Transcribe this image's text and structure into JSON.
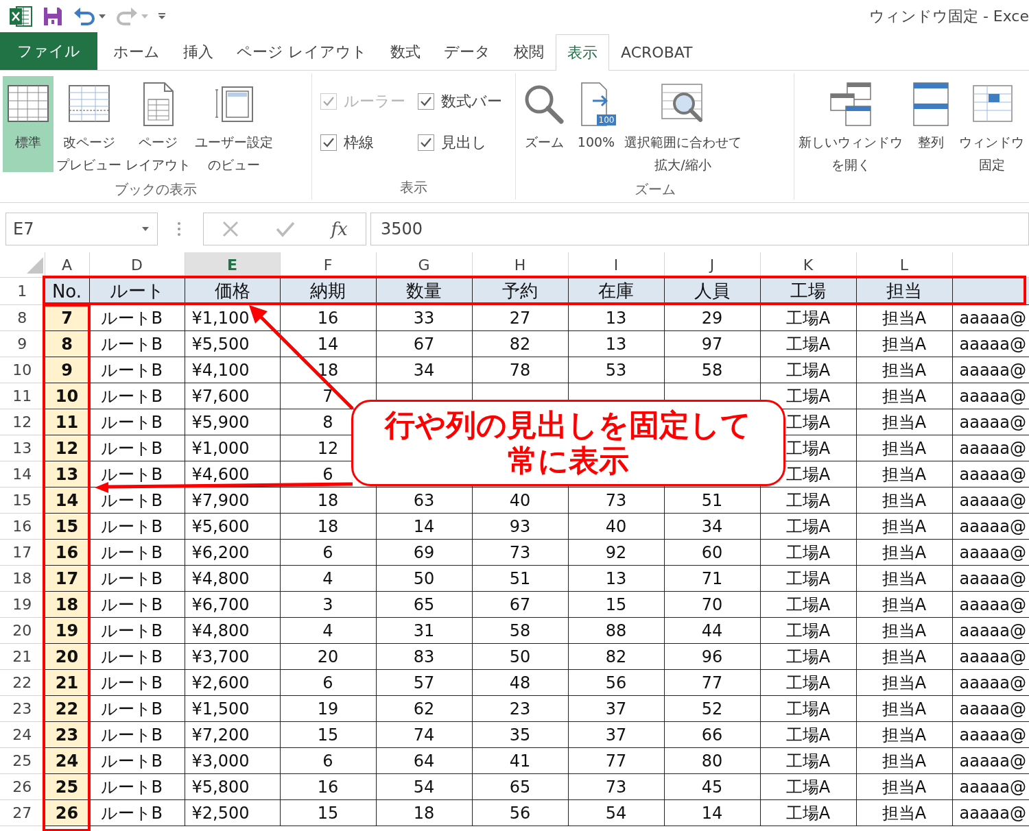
{
  "title_bar": {
    "title": "ウィンドウ固定 - Exce"
  },
  "tabs": [
    {
      "label": "ファイル",
      "kind": "file",
      "selected": false
    },
    {
      "label": "ホーム",
      "kind": "tab",
      "selected": false
    },
    {
      "label": "挿入",
      "kind": "tab",
      "selected": false
    },
    {
      "label": "ページ レイアウト",
      "kind": "tab",
      "selected": false
    },
    {
      "label": "数式",
      "kind": "tab",
      "selected": false
    },
    {
      "label": "データ",
      "kind": "tab",
      "selected": false
    },
    {
      "label": "校閲",
      "kind": "tab",
      "selected": false
    },
    {
      "label": "表示",
      "kind": "tab",
      "selected": true
    },
    {
      "label": "ACROBAT",
      "kind": "tab",
      "selected": false
    }
  ],
  "ribbon": {
    "groups": [
      {
        "label": "ブックの表示",
        "kind": "buttons",
        "items": [
          {
            "lines": [
              "標準"
            ],
            "selected": true
          },
          {
            "lines": [
              "改ページ",
              "プレビュー"
            ],
            "selected": false
          },
          {
            "lines": [
              "ページ",
              "レイアウト"
            ],
            "selected": false
          },
          {
            "lines": [
              "ユーザー設定",
              "のビュー"
            ],
            "selected": false
          }
        ]
      },
      {
        "label": "表示",
        "kind": "checks",
        "items": [
          {
            "label": "ルーラー",
            "checked": true,
            "disabled": true
          },
          {
            "label": "数式バー",
            "checked": true,
            "disabled": false
          },
          {
            "label": "枠線",
            "checked": true,
            "disabled": false
          },
          {
            "label": "見出し",
            "checked": true,
            "disabled": false
          }
        ]
      },
      {
        "label": "ズーム",
        "kind": "buttons",
        "items": [
          {
            "lines": [
              "ズーム"
            ],
            "selected": false
          },
          {
            "badge": "100",
            "lines": [
              "100%"
            ],
            "selected": false
          },
          {
            "lines": [
              "選択範囲に合わせて",
              "拡大/縮小"
            ],
            "selected": false
          }
        ]
      },
      {
        "kind": "buttons",
        "items": [
          {
            "lines": [
              "新しいウィンドウ",
              "を開く"
            ],
            "selected": false
          },
          {
            "lines": [
              "整列"
            ],
            "selected": false
          },
          {
            "lines": [
              "ウィンドウ",
              "固定"
            ],
            "selected": false
          }
        ]
      }
    ]
  },
  "formula_bar": {
    "name_box": "E7",
    "function_label": "fx",
    "value": "3500"
  },
  "sheet": {
    "columns": [
      {
        "letter": "A",
        "selected": false
      },
      {
        "letter": "D",
        "selected": false
      },
      {
        "letter": "E",
        "selected": true
      },
      {
        "letter": "F",
        "selected": false
      },
      {
        "letter": "G",
        "selected": false
      },
      {
        "letter": "H",
        "selected": false
      },
      {
        "letter": "I",
        "selected": false
      },
      {
        "letter": "J",
        "selected": false
      },
      {
        "letter": "K",
        "selected": false
      },
      {
        "letter": "L",
        "selected": false
      },
      {
        "selected": false
      }
    ],
    "header_row": {
      "row": "1",
      "cells": [
        "No.",
        "ルート",
        "価格",
        "納期",
        "数量",
        "予約",
        "在庫",
        "人員",
        "工場",
        "担当",
        null
      ]
    },
    "rows": [
      {
        "row": "8",
        "cells": [
          "7",
          "ルートB",
          "¥1,100",
          "16",
          "33",
          "27",
          "13",
          "29",
          "工場A",
          "担当A",
          "aaaaa@"
        ]
      },
      {
        "row": "9",
        "cells": [
          "8",
          "ルートB",
          "¥5,500",
          "14",
          "67",
          "82",
          "13",
          "97",
          "工場A",
          "担当A",
          "aaaaa@"
        ]
      },
      {
        "row": "10",
        "cells": [
          "9",
          "ルートB",
          "¥4,100",
          "18",
          "34",
          "78",
          "53",
          "58",
          "工場A",
          "担当A",
          "aaaaa@"
        ]
      },
      {
        "row": "11",
        "cells": [
          "10",
          "ルートB",
          "¥7,600",
          "7",
          null,
          null,
          null,
          null,
          "工場A",
          "担当A",
          "aaaaa@"
        ]
      },
      {
        "row": "12",
        "cells": [
          "11",
          "ルートB",
          "¥5,900",
          "8",
          null,
          null,
          null,
          null,
          "工場A",
          "担当A",
          "aaaaa@"
        ]
      },
      {
        "row": "13",
        "cells": [
          "12",
          "ルートB",
          "¥1,000",
          "12",
          null,
          null,
          null,
          null,
          "工場A",
          "担当A",
          "aaaaa@"
        ]
      },
      {
        "row": "14",
        "cells": [
          "13",
          "ルートB",
          "¥4,600",
          "6",
          null,
          null,
          null,
          null,
          "工場A",
          "担当A",
          "aaaaa@"
        ]
      },
      {
        "row": "15",
        "cells": [
          "14",
          "ルートB",
          "¥7,900",
          "18",
          "63",
          "40",
          "73",
          "51",
          "工場A",
          "担当A",
          "aaaaa@"
        ]
      },
      {
        "row": "16",
        "cells": [
          "15",
          "ルートB",
          "¥5,600",
          "18",
          "14",
          "93",
          "40",
          "34",
          "工場A",
          "担当A",
          "aaaaa@"
        ]
      },
      {
        "row": "17",
        "cells": [
          "16",
          "ルートB",
          "¥6,200",
          "6",
          "69",
          "73",
          "92",
          "60",
          "工場A",
          "担当A",
          "aaaaa@"
        ]
      },
      {
        "row": "18",
        "cells": [
          "17",
          "ルートB",
          "¥4,800",
          "4",
          "50",
          "51",
          "13",
          "71",
          "工場A",
          "担当A",
          "aaaaa@"
        ]
      },
      {
        "row": "19",
        "cells": [
          "18",
          "ルートB",
          "¥6,700",
          "3",
          "65",
          "67",
          "15",
          "70",
          "工場A",
          "担当A",
          "aaaaa@"
        ]
      },
      {
        "row": "20",
        "cells": [
          "19",
          "ルートB",
          "¥4,800",
          "4",
          "31",
          "58",
          "88",
          "44",
          "工場A",
          "担当A",
          "aaaaa@"
        ]
      },
      {
        "row": "21",
        "cells": [
          "20",
          "ルートB",
          "¥3,700",
          "20",
          "83",
          "50",
          "82",
          "96",
          "工場A",
          "担当A",
          "aaaaa@"
        ]
      },
      {
        "row": "22",
        "cells": [
          "21",
          "ルートB",
          "¥2,600",
          "6",
          "57",
          "48",
          "56",
          "77",
          "工場A",
          "担当A",
          "aaaaa@"
        ]
      },
      {
        "row": "23",
        "cells": [
          "22",
          "ルートB",
          "¥1,500",
          "19",
          "62",
          "23",
          "37",
          "52",
          "工場A",
          "担当A",
          "aaaaa@"
        ]
      },
      {
        "row": "24",
        "cells": [
          "23",
          "ルートB",
          "¥7,200",
          "15",
          "74",
          "35",
          "37",
          "66",
          "工場A",
          "担当A",
          "aaaaa@"
        ]
      },
      {
        "row": "25",
        "cells": [
          "24",
          "ルートB",
          "¥3,000",
          "6",
          "64",
          "41",
          "77",
          "80",
          "工場A",
          "担当A",
          "aaaaa@"
        ]
      },
      {
        "row": "26",
        "cells": [
          "25",
          "ルートB",
          "¥5,800",
          "16",
          "54",
          "65",
          "73",
          "45",
          "工場A",
          "担当A",
          "aaaaa@"
        ]
      },
      {
        "row": "27",
        "cells": [
          "26",
          "ルートB",
          "¥2,500",
          "15",
          "18",
          "56",
          "54",
          "14",
          "工場A",
          "担当A",
          "aaaaa@"
        ]
      }
    ]
  },
  "callout": {
    "text": "行や列の見出しを固定して常に表示"
  }
}
